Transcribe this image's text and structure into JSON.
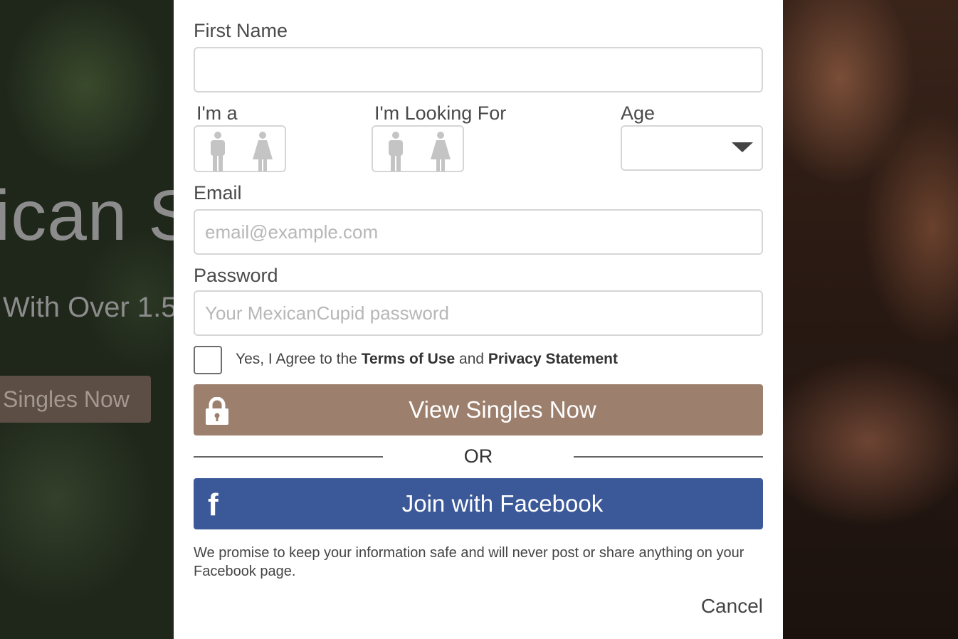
{
  "background": {
    "hero_title": "ican S",
    "hero_subtitle": "With Over 1.5",
    "hero_button": "Singles Now"
  },
  "form": {
    "first_name": {
      "label": "First Name",
      "value": ""
    },
    "im_a": {
      "label": "I'm a",
      "options": [
        "male-icon",
        "female-icon"
      ]
    },
    "looking_for": {
      "label": "I'm Looking For",
      "options": [
        "male-icon",
        "female-icon"
      ]
    },
    "age": {
      "label": "Age",
      "selected": ""
    },
    "email": {
      "label": "Email",
      "placeholder": "email@example.com",
      "value": ""
    },
    "password": {
      "label": "Password",
      "placeholder": "Your MexicanCupid password",
      "value": ""
    },
    "agree": {
      "prefix": "Yes, I Agree to the ",
      "terms": "Terms of Use",
      "and": " and ",
      "privacy": "Privacy Statement",
      "checked": false
    },
    "submit_label": "View Singles Now",
    "or_label": "OR",
    "facebook_label": "Join with Facebook",
    "facebook_icon": "f",
    "promise": "We promise to keep your information safe and will never post or share anything on your Facebook page.",
    "cancel_label": "Cancel"
  },
  "colors": {
    "primary_button": "#9c7f6d",
    "facebook_button": "#3b5998"
  }
}
